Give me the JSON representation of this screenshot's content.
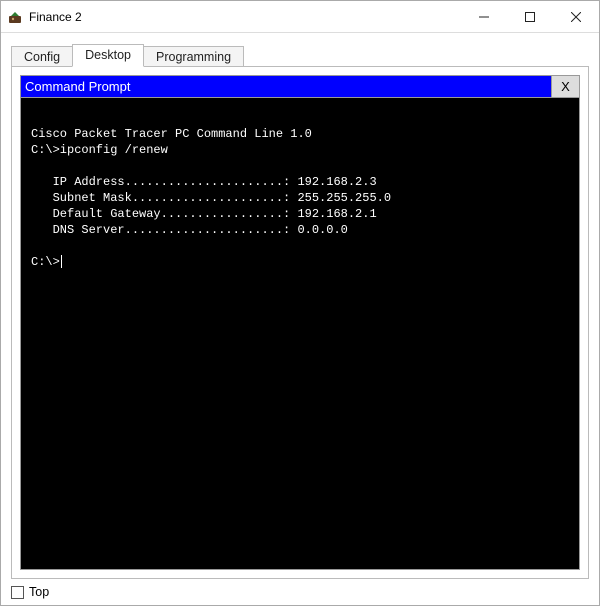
{
  "window": {
    "title": "Finance 2"
  },
  "tabs": {
    "items": [
      {
        "label": "Config",
        "active": false
      },
      {
        "label": "Desktop",
        "active": true
      },
      {
        "label": "Programming",
        "active": false
      }
    ]
  },
  "cmd": {
    "title": "Command Prompt",
    "close_label": "X"
  },
  "terminal": {
    "lines": [
      "",
      "Cisco Packet Tracer PC Command Line 1.0",
      "C:\\>ipconfig /renew",
      "",
      "   IP Address......................: 192.168.2.3",
      "   Subnet Mask.....................: 255.255.255.0",
      "   Default Gateway.................: 192.168.2.1",
      "   DNS Server......................: 0.0.0.0",
      "",
      "C:\\>"
    ]
  },
  "footer": {
    "checkbox_label": "Top",
    "checked": false
  }
}
